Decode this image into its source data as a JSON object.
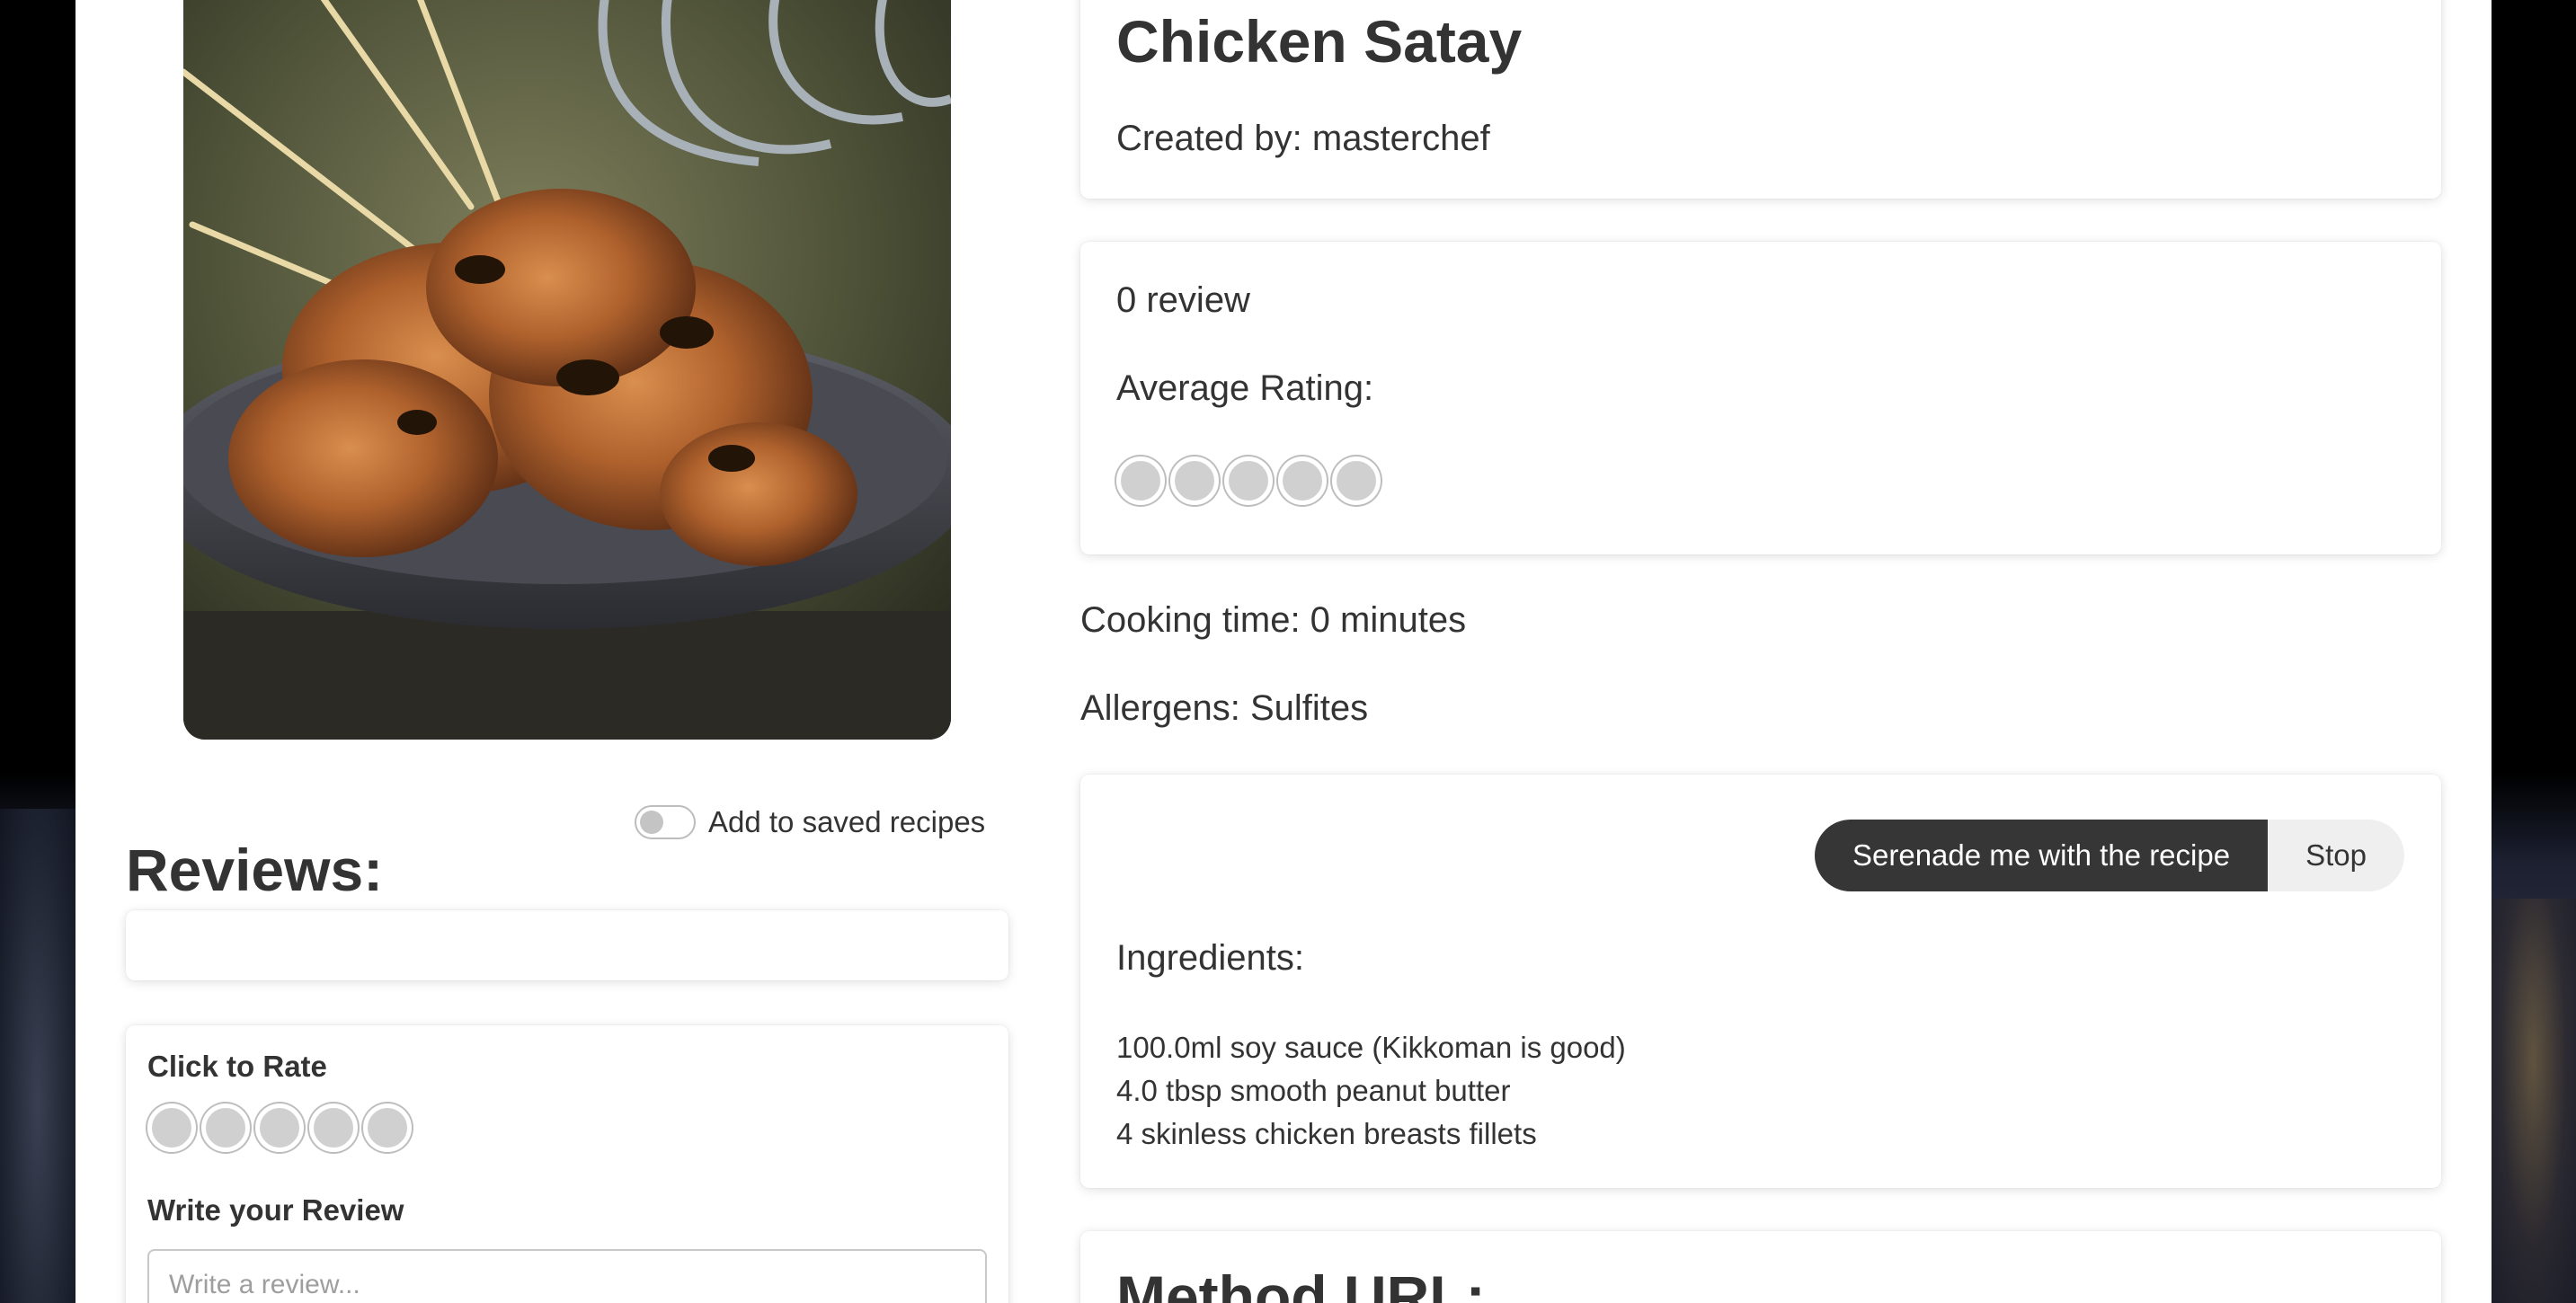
{
  "recipe": {
    "title": "Chicken Satay",
    "created_by": "Created by: masterchef",
    "review_count": "0 review",
    "average_rating_label": "Average Rating:",
    "average_rating_value": 0,
    "rating_max": 5,
    "cooking_time": "Cooking time: 0 minutes",
    "allergens": "Allergens: Sulfites"
  },
  "save_toggle": {
    "label": "Add to saved recipes",
    "checked": false
  },
  "reviews": {
    "title": "Reviews:"
  },
  "rate_form": {
    "click_to_rate_label": "Click to Rate",
    "write_review_label": "Write your Review",
    "review_placeholder": "Write a review..."
  },
  "audio_controls": {
    "play_label": "Serenade me with the recipe",
    "stop_label": "Stop"
  },
  "ingredients": {
    "label": "Ingredients:",
    "items": [
      "100.0ml soy sauce (Kikkoman is good)",
      "4.0 tbsp smooth peanut butter",
      "4 skinless chicken breasts fillets"
    ]
  },
  "method": {
    "title": "Method URL:"
  },
  "colors": {
    "dark_button": "#363636",
    "light_button": "#efefef",
    "rating_circle": "#d0d0d0"
  }
}
